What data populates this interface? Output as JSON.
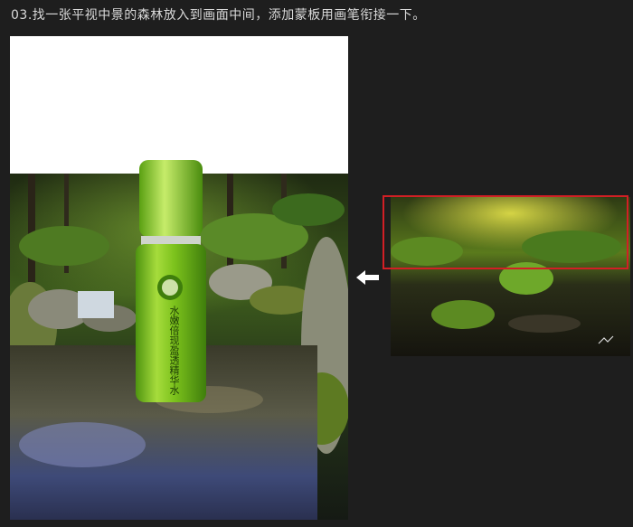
{
  "title": "03.找一张平视中景的森林放入到画面中间，添加蒙板用画笔衔接一下。",
  "product": {
    "label": "水嫩倍现盈透精华水"
  },
  "arrow_icon": "left-arrow-icon",
  "colors": {
    "background": "#1e1e1e",
    "title_text": "#d9d9d9",
    "selection_box": "#d21f25",
    "bottle_green": "#7cc21c"
  }
}
